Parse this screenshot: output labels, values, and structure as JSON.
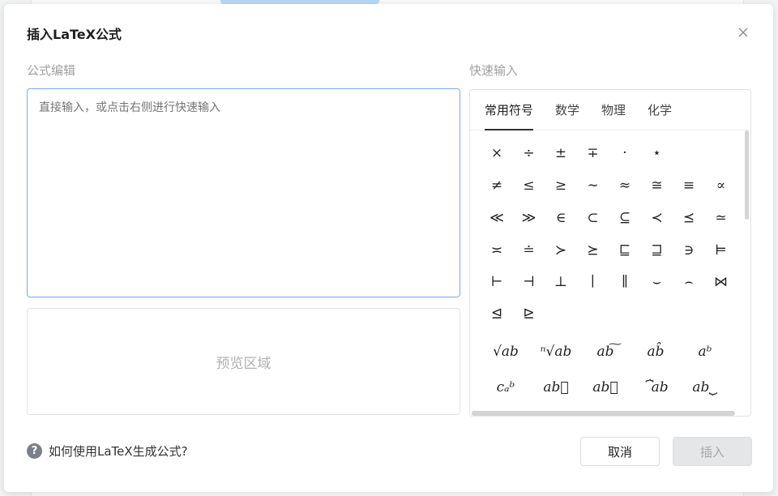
{
  "dialog": {
    "title": "插入LaTeX公式",
    "editor_label": "公式编辑",
    "editor_placeholder": "直接输入，或点击右侧进行快速输入",
    "editor_value": "",
    "preview_placeholder": "预览区域",
    "quick_label": "快速输入",
    "help_text": "如何使用LaTeX生成公式?",
    "cancel_label": "取消",
    "insert_label": "插入"
  },
  "tabs": [
    {
      "label": "常用符号",
      "active": true
    },
    {
      "label": "数学",
      "active": false
    },
    {
      "label": "物理",
      "active": false
    },
    {
      "label": "化学",
      "active": false
    }
  ],
  "symbols": [
    "×",
    "÷",
    "±",
    "∓",
    "·",
    "⋆",
    "≠",
    "≤",
    "≥",
    "∼",
    "≈",
    "≅",
    "≡",
    "∝",
    "≪",
    "≫",
    "∈",
    "⊂",
    "⊆",
    "≺",
    "⪯",
    "≃",
    "≍",
    "≐",
    "≻",
    "⪰",
    "⊑",
    "⊒",
    "∋",
    "⊨",
    "⊢",
    "⊣",
    "⊥",
    "∣",
    "∥",
    "⌣",
    "⌢",
    "⋈",
    "⊴",
    "⊵"
  ],
  "templates": [
    "√ab",
    "ⁿ√ab",
    "ab͠",
    "ab̂",
    "aᵇ",
    "cₐᵇ",
    "ab⃖",
    "ab⃗",
    "⏞ab",
    "ab⏟"
  ]
}
